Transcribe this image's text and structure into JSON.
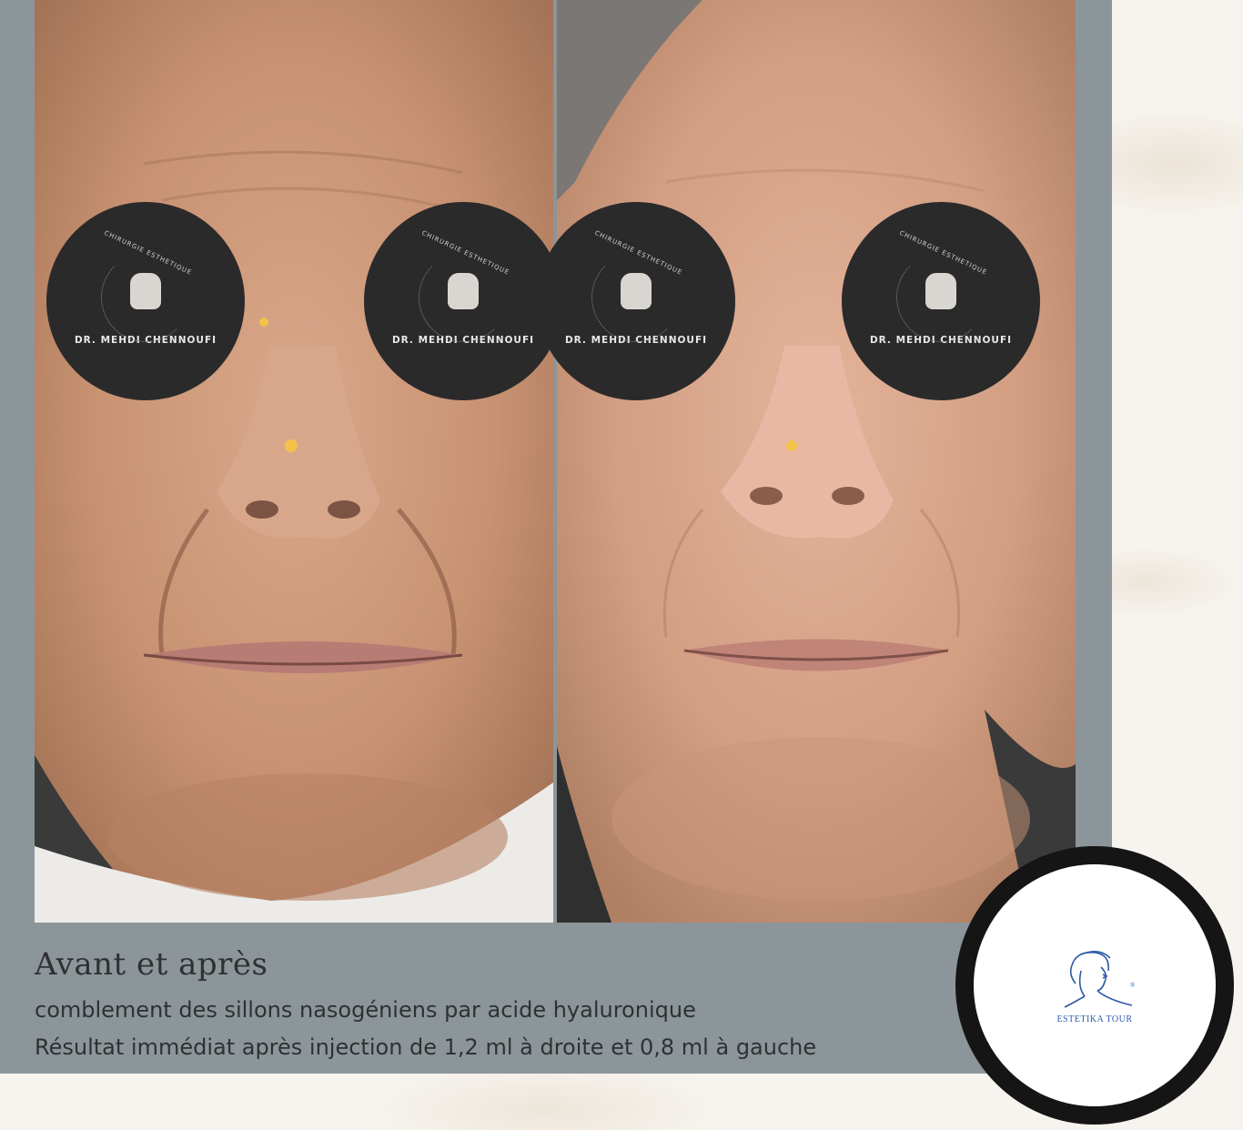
{
  "watermark": {
    "name": "DR. MEHDI CHENNOUFI",
    "arc_text": "CHIRURGIE ESTHETIQUE"
  },
  "caption": {
    "title": "Avant et après",
    "line1": "comblement des sillons nasogéniens par acide hyaluronique",
    "line2": "Résultat immédiat après injection de 1,2 ml à droite et 0,8 ml à gauche"
  },
  "logo": {
    "label": "ESTETIKA TOUR",
    "mark": "®",
    "color": "#2c5aa8"
  },
  "colors": {
    "frame": "#8c969a",
    "watermark_disc": "#2b2a2b",
    "text": "#2f3131"
  }
}
